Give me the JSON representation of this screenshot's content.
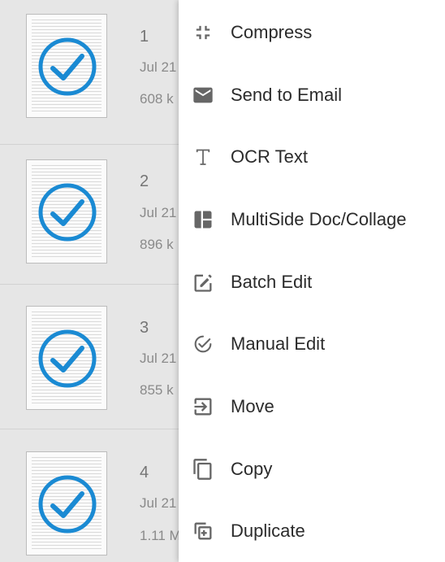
{
  "documents": [
    {
      "name": "1",
      "date": "Jul 21",
      "size": "608 k"
    },
    {
      "name": "2",
      "date": "Jul 21",
      "size": "896 k"
    },
    {
      "name": "3",
      "date": "Jul 21",
      "size": "855 k"
    },
    {
      "name": "4",
      "date": "Jul 21",
      "size": "1.11 M"
    }
  ],
  "menu": {
    "items": [
      {
        "label": "Compress",
        "icon": "compress-icon"
      },
      {
        "label": "Send to Email",
        "icon": "email-icon"
      },
      {
        "label": "OCR Text",
        "icon": "text-icon"
      },
      {
        "label": "MultiSide Doc/Collage",
        "icon": "collage-icon"
      },
      {
        "label": "Batch Edit",
        "icon": "edit-icon"
      },
      {
        "label": "Manual Edit",
        "icon": "manual-edit-icon"
      },
      {
        "label": "Move",
        "icon": "move-icon"
      },
      {
        "label": "Copy",
        "icon": "copy-icon"
      },
      {
        "label": "Duplicate",
        "icon": "duplicate-icon"
      }
    ]
  },
  "colors": {
    "check": "#1a8ad3",
    "icon": "#666666",
    "menu_bg": "#ffffff",
    "list_bg": "#e6e6e6"
  }
}
